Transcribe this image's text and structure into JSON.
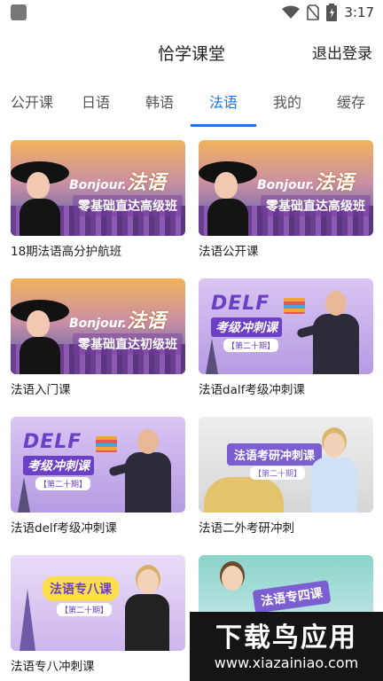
{
  "status_bar": {
    "time": "3:17"
  },
  "header": {
    "title": "恰学课堂",
    "logout_label": "退出登录"
  },
  "tabs": [
    {
      "label": "公开课"
    },
    {
      "label": "日语"
    },
    {
      "label": "韩语"
    },
    {
      "label": "法语",
      "active": true
    },
    {
      "label": "我的"
    },
    {
      "label": "缓存"
    }
  ],
  "courses": [
    {
      "title": "18期法语高分护航班",
      "thumb": {
        "line1a": "Bonjour.",
        "line1b": "法语",
        "line2": "零基础直达高级班"
      }
    },
    {
      "title": "法语公开课",
      "thumb": {
        "line1a": "Bonjour.",
        "line1b": "法语",
        "line2": "零基础直达高级班"
      }
    },
    {
      "title": "法语入门课",
      "thumb": {
        "line1a": "Bonjour.",
        "line1b": "法语",
        "line2": "零基础直达初级班"
      }
    },
    {
      "title": "法语dalf考级冲刺课",
      "thumb": {
        "word": "DELF",
        "sub": "考级冲刺课",
        "issue": "【第二十期】"
      }
    },
    {
      "title": "法语delf考级冲刺课",
      "thumb": {
        "word": "DELF",
        "sub": "考级冲刺课",
        "issue": "【第二十期】"
      }
    },
    {
      "title": "法语二外考研冲刺",
      "thumb": {
        "main": "法语考研冲刺课",
        "issue": "【第二十期】"
      }
    },
    {
      "title": "法语专八冲刺课",
      "thumb": {
        "main": "法语专八课",
        "issue": "【第二十期】"
      }
    },
    {
      "title": "",
      "thumb": {
        "main": "法语专四课"
      }
    }
  ],
  "watermark": {
    "brand": "下载鸟应用",
    "url": "www.xiazainiao.com"
  }
}
